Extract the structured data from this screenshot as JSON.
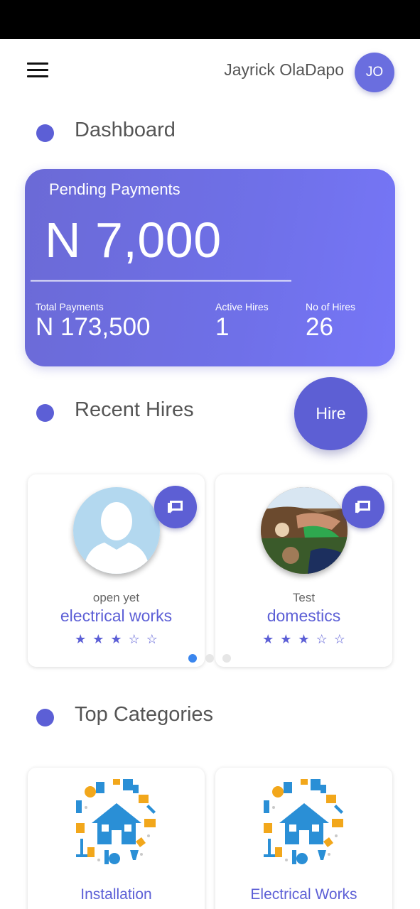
{
  "header": {
    "user_name": "Jayrick OlaDapo",
    "avatar_initials": "JO"
  },
  "dashboard": {
    "title": "Dashboard",
    "pending_label": "Pending Payments",
    "pending_amount": "N 7,000",
    "stats": {
      "total_label": "Total Payments",
      "total_value": "N 173,500",
      "active_label": "Active Hires",
      "active_value": "1",
      "hires_label": "No of Hires",
      "hires_value": "26"
    }
  },
  "recent_hires": {
    "title": "Recent Hires",
    "hire_button": "Hire",
    "items": [
      {
        "name": "open yet",
        "category": "electrical works",
        "stars": "★★★☆☆",
        "rating": 3,
        "photo": "default-person-avatar"
      },
      {
        "name": "Test",
        "category": "domestics",
        "stars": "★★★☆☆",
        "rating": 3,
        "photo": "user-photo"
      }
    ],
    "pager": {
      "count": 3,
      "active": 1
    }
  },
  "top_categories": {
    "title": "Top Categories",
    "items": [
      {
        "label": "Installation",
        "icon": "home-cleaning-illustration"
      },
      {
        "label": "Electrical Works",
        "icon": "home-cleaning-illustration"
      }
    ]
  },
  "colors": {
    "accent": "#5c5fd6",
    "card_gradient_start": "#6b6ad6",
    "card_gradient_end": "#7676f7",
    "pager_active": "#3a86ee"
  }
}
